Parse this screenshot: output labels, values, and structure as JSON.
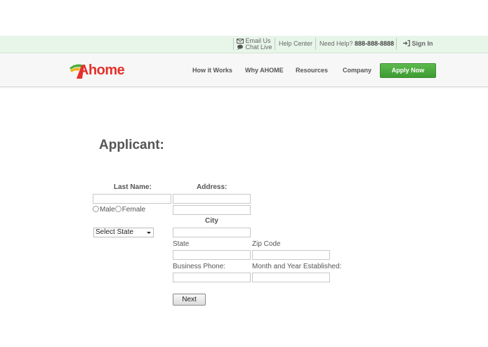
{
  "topbar": {
    "email_label": "Email Us",
    "chat_label": "Chat Live",
    "help_center": "Help Center",
    "need_help": "Need Help?",
    "phone": "888-888-8888",
    "sign_in": "Sign In"
  },
  "header": {
    "logo_text": "Ahome",
    "nav": [
      "How it Works",
      "Why AHOME",
      "Resources",
      "Company"
    ],
    "apply_label": "Apply Now"
  },
  "form": {
    "title": "Applicant:",
    "last_name_label": "Last Name:",
    "address_label": "Address:",
    "gender_male": "Male",
    "gender_female": "Female",
    "city_label": "City",
    "state_select": "Select State",
    "state_label": "State",
    "zip_label": "Zip Code",
    "business_phone_label": "Business Phone:",
    "month_year_label": "Month and Year Established:",
    "next_label": "Next"
  },
  "colors": {
    "topbar_bg": "#e8f5e9",
    "brand_red": "#e4312a",
    "brand_green": "#4caf3c",
    "apply_green": "#3e9b33"
  }
}
